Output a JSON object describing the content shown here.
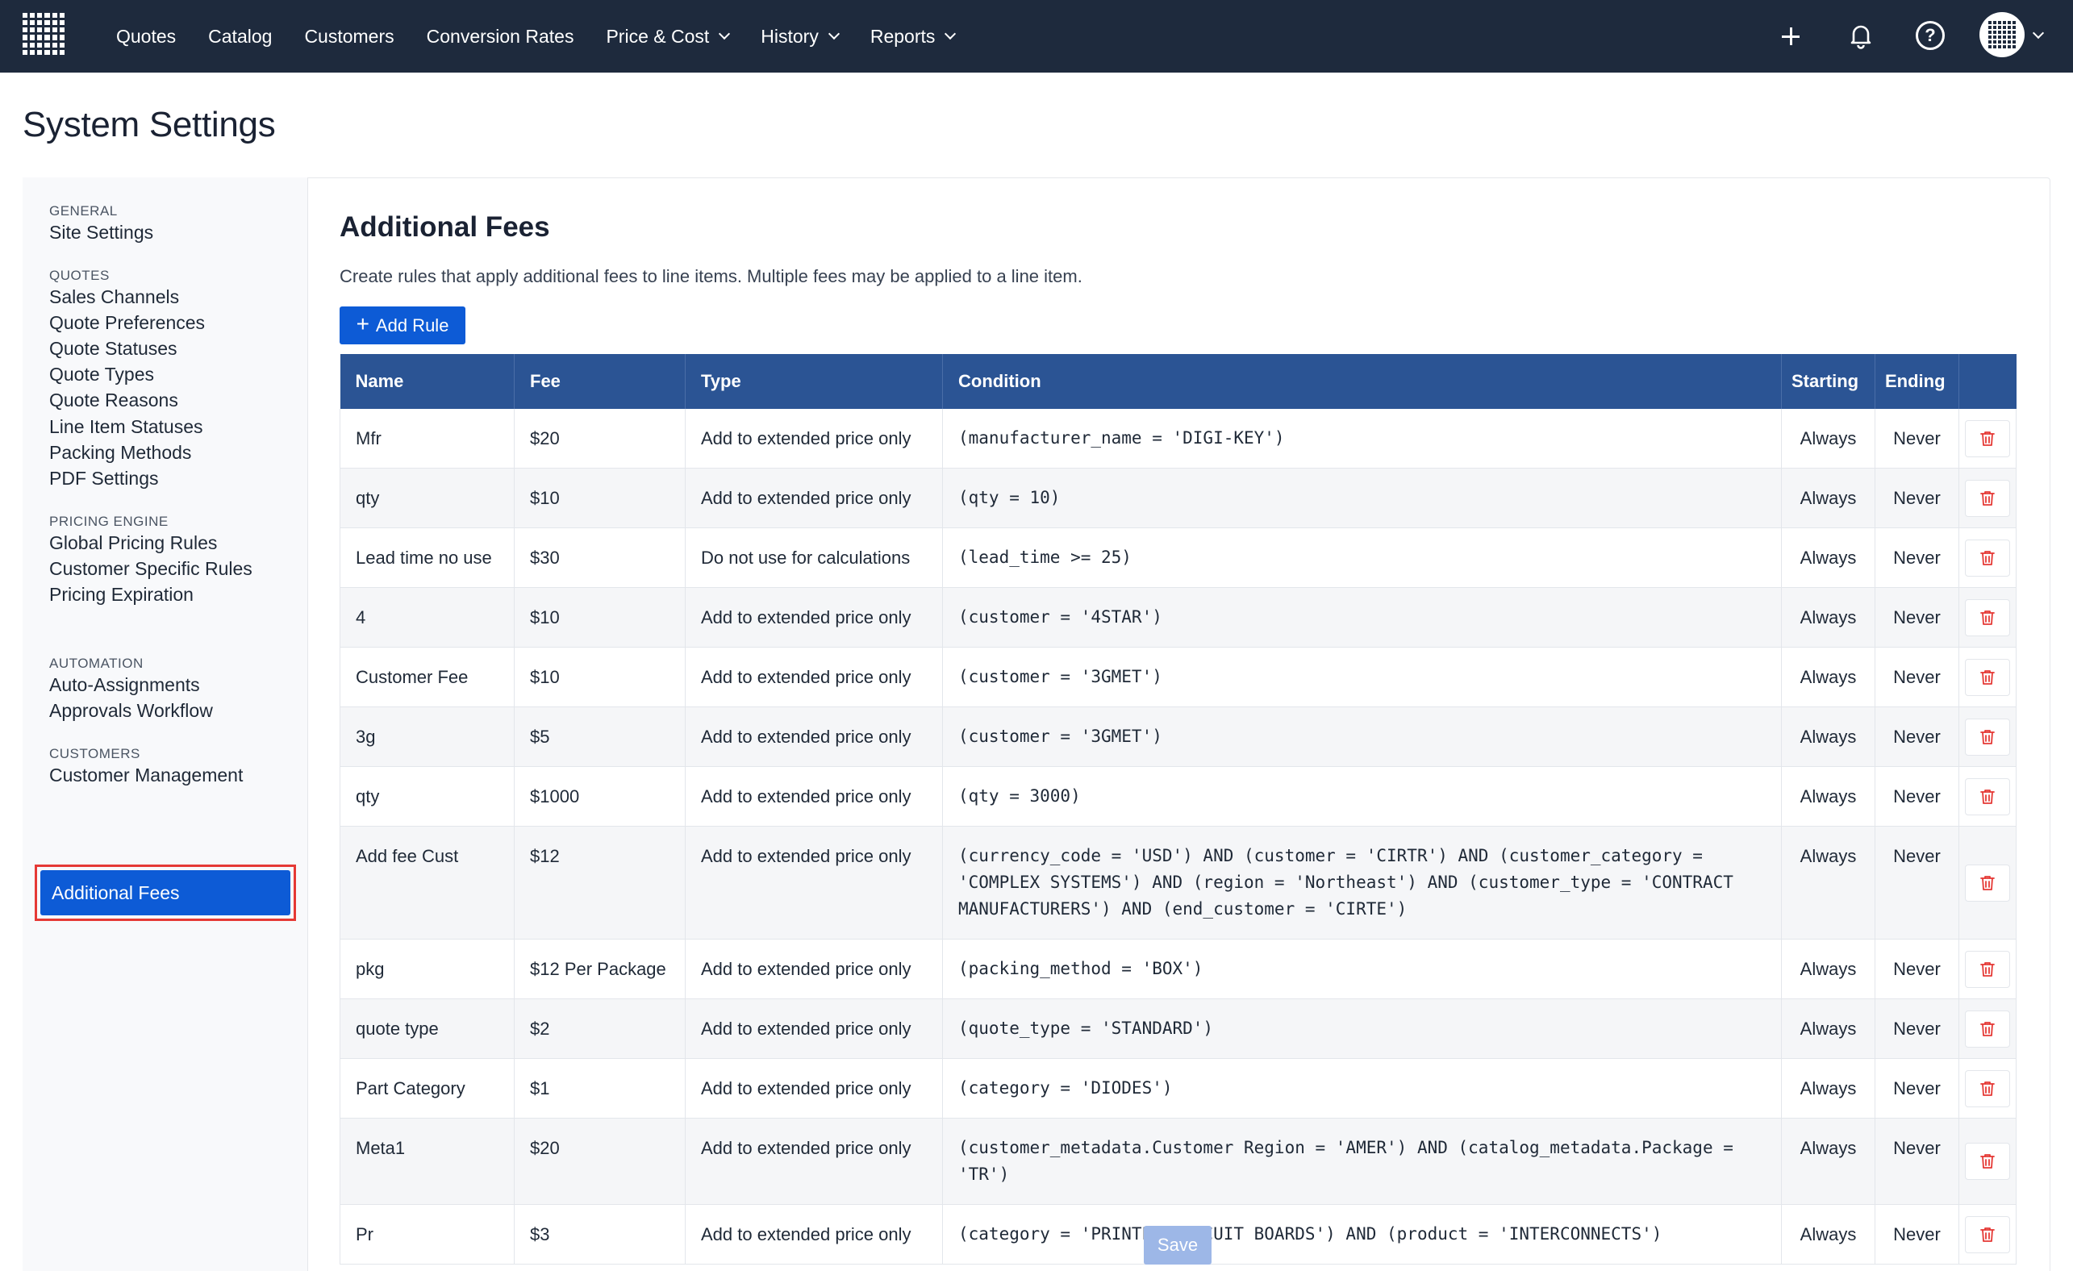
{
  "nav": {
    "items": [
      {
        "label": "Quotes",
        "dropdown": false
      },
      {
        "label": "Catalog",
        "dropdown": false
      },
      {
        "label": "Customers",
        "dropdown": false
      },
      {
        "label": "Conversion Rates",
        "dropdown": false
      },
      {
        "label": "Price & Cost",
        "dropdown": true
      },
      {
        "label": "History",
        "dropdown": true
      },
      {
        "label": "Reports",
        "dropdown": true
      }
    ],
    "icons": [
      "grid-logo-icon",
      "plus-icon",
      "bell-icon",
      "help-icon",
      "avatar-icon",
      "chevron-down-icon"
    ]
  },
  "page": {
    "title": "System Settings"
  },
  "sidebar": {
    "sections": [
      {
        "title": "GENERAL",
        "items": [
          "Site Settings"
        ]
      },
      {
        "title": "QUOTES",
        "items": [
          "Sales Channels",
          "Quote Preferences",
          "Quote Statuses",
          "Quote Types",
          "Quote Reasons",
          "Line Item Statuses",
          "Packing Methods",
          "PDF Settings"
        ]
      },
      {
        "title": "PRICING ENGINE",
        "items": [
          "Global Pricing Rules",
          "Customer Specific Rules",
          "Pricing Expiration",
          "Additional Fees"
        ]
      },
      {
        "title": "AUTOMATION",
        "items": [
          "Auto-Assignments",
          "Approvals Workflow"
        ]
      },
      {
        "title": "CUSTOMERS",
        "items": [
          "Customer Management"
        ]
      }
    ],
    "active": "Additional Fees"
  },
  "main": {
    "title": "Additional Fees",
    "description": "Create rules that apply additional fees to line items. Multiple fees may be applied to a line item.",
    "add_button": "Add Rule",
    "save_button": "Save",
    "columns": [
      "Name",
      "Fee",
      "Type",
      "Condition",
      "Starting",
      "Ending"
    ],
    "rows": [
      {
        "name": "Mfr",
        "fee": "$20",
        "type": "Add to extended price only",
        "condition": "(manufacturer_name = 'DIGI-KEY')",
        "starting": "Always",
        "ending": "Never"
      },
      {
        "name": "qty",
        "fee": "$10",
        "type": "Add to extended price only",
        "condition": "(qty = 10)",
        "starting": "Always",
        "ending": "Never"
      },
      {
        "name": "Lead time no use",
        "fee": "$30",
        "type": "Do not use for calculations",
        "condition": "(lead_time >= 25)",
        "starting": "Always",
        "ending": "Never"
      },
      {
        "name": "4",
        "fee": "$10",
        "type": "Add to extended price only",
        "condition": "(customer = '4STAR')",
        "starting": "Always",
        "ending": "Never"
      },
      {
        "name": "Customer Fee",
        "fee": "$10",
        "type": "Add to extended price only",
        "condition": "(customer = '3GMET')",
        "starting": "Always",
        "ending": "Never"
      },
      {
        "name": "3g",
        "fee": "$5",
        "type": "Add to extended price only",
        "condition": "(customer = '3GMET')",
        "starting": "Always",
        "ending": "Never"
      },
      {
        "name": "qty",
        "fee": "$1000",
        "type": "Add to extended price only",
        "condition": "(qty = 3000)",
        "starting": "Always",
        "ending": "Never"
      },
      {
        "name": "Add fee Cust",
        "fee": "$12",
        "type": "Add to extended price only",
        "condition": "(currency_code = 'USD') AND (customer = 'CIRTR') AND (customer_category = 'COMPLEX SYSTEMS') AND (region = 'Northeast') AND (customer_type = 'CONTRACT MANUFACTURERS') AND (end_customer = 'CIRTE')",
        "starting": "Always",
        "ending": "Never"
      },
      {
        "name": "pkg",
        "fee": "$12 Per Package",
        "type": "Add to extended price only",
        "condition": "(packing_method = 'BOX')",
        "starting": "Always",
        "ending": "Never"
      },
      {
        "name": "quote type",
        "fee": "$2",
        "type": "Add to extended price only",
        "condition": "(quote_type = 'STANDARD')",
        "starting": "Always",
        "ending": "Never"
      },
      {
        "name": "Part Category",
        "fee": "$1",
        "type": "Add to extended price only",
        "condition": "(category = 'DIODES')",
        "starting": "Always",
        "ending": "Never"
      },
      {
        "name": "Meta1",
        "fee": "$20",
        "type": "Add to extended price only",
        "condition": "(customer_metadata.Customer Region = 'AMER') AND (catalog_metadata.Package = 'TR')",
        "starting": "Always",
        "ending": "Never"
      },
      {
        "name": "Pr",
        "fee": "$3",
        "type": "Add to extended price only",
        "condition": "(category = 'PRINTED CIRCUIT BOARDS') AND (product = 'INTERCONNECTS')",
        "starting": "Always",
        "ending": "Never"
      }
    ]
  },
  "colors": {
    "topbar": "#1e2a3d",
    "primary": "#0d5bd6",
    "table_header": "#2b5494",
    "delete_icon": "#e53935",
    "highlight_border": "#e53935"
  }
}
